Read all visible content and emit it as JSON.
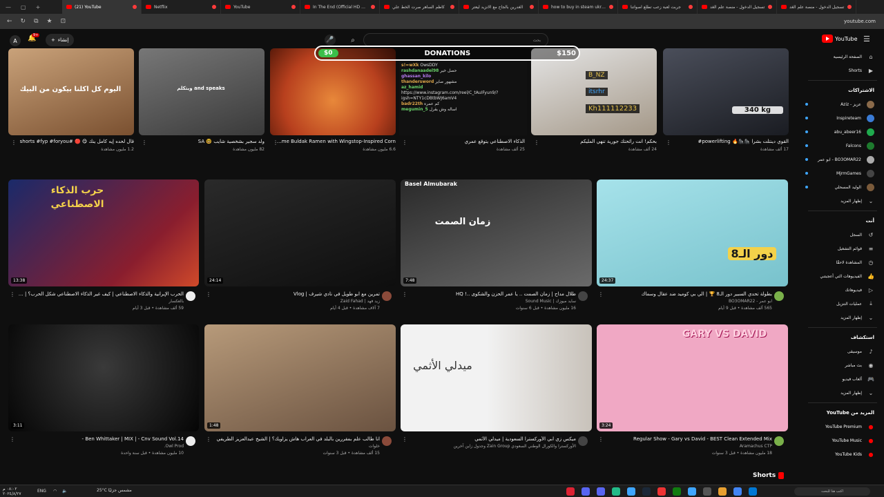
{
  "browser": {
    "tabs": [
      {
        "label": "(21) YouTube",
        "active": true
      },
      {
        "label": "Netflix"
      },
      {
        "label": "YouTube"
      },
      {
        "label": "In The End (Official HD Music"
      },
      {
        "label": "كاظم الساهر صرت الخط علي"
      },
      {
        "label": "الغدرين بالجاح مع الانزيد ليعتر"
      },
      {
        "label": "how to buy in steam ukraine"
      },
      {
        "label": "جربت لعبة زعب تطلع اصواتنا"
      },
      {
        "label": "تسجيل الدخول - منصة علم الغد"
      },
      {
        "label": "تسجيل الدخول - منصة علم الغد"
      }
    ],
    "url": "youtube.com"
  },
  "header": {
    "avatar_letter": "A",
    "notif_count": "9+",
    "create_label": "إنشاء",
    "search_placeholder": "بحث",
    "logo_text": "YouTube"
  },
  "sidebar": {
    "main": [
      "الصفحة الرئيسية",
      "Shorts"
    ],
    "subs_title": "الاشتراكات",
    "subs": [
      {
        "name": "عزيز - Aziz",
        "color": "#8a6a4a"
      },
      {
        "name": "Inspireteam",
        "color": "#3a7bd5"
      },
      {
        "name": "abu_abeer16",
        "color": "#1faa4d"
      },
      {
        "name": "Falcons",
        "color": "#1e7a2e"
      },
      {
        "name": "BO3OMAR22 - ابو عمر",
        "color": "#aaaaaa"
      },
      {
        "name": "MjrmGames",
        "color": "#444444"
      },
      {
        "name": "الوليد المسحلي",
        "color": "#7a5a3a"
      }
    ],
    "subs_more": "إظهار المزيد",
    "you_title": "أنت",
    "you_items": [
      "السجل",
      "قوائم التشغيل",
      "المشاهدة لاحقًا",
      "الفيديوهات التي أعجبتني",
      "فيديوهاتك",
      "عمليات التنزيل",
      "إظهار المزيد"
    ],
    "explore_title": "استكشاف",
    "explore_items": [
      "موسيقى",
      "بث مباشر",
      "ألعاب فيديو",
      "إظهار المزيد"
    ],
    "more_title": "المزيد من YouTube",
    "more_items": [
      "YouTube Premium",
      "YouTube Music",
      "YouTube Kids"
    ]
  },
  "stream": {
    "left_amount": "$0",
    "title": "DONATIONS",
    "right_amount": "$150",
    "chat": [
      {
        "u": "s!=wXk",
        "m": "OwsDDY"
      },
      {
        "u": "rashdanaadel98",
        "m": "حصل خير"
      },
      {
        "u": "ghassan_kilo",
        "m": ""
      },
      {
        "u": "thandersword",
        "m": "مشهور صاير"
      },
      {
        "u": "az_hamid",
        "m": ""
      },
      {
        "u": "",
        "m": "https://www.instagram.com/reel/C_tAuIFyun9/?igsh=NTY1cDBtbWJ6amV4"
      },
      {
        "u": "badr22th",
        "m": "كم عمره"
      },
      {
        "u": "megumin_5",
        "m": "اساله وش يقرل"
      }
    ],
    "nick1": "B_NZ",
    "nick2": "itsrhr",
    "nick3": "Kh111112233",
    "kg": "340 kg"
  },
  "row1": [
    {
      "title": "قال لحده إيه كامل ينك 😋 🔴 #shorts #fyp #foryou",
      "meta": "1.2 مليون مشاهدة",
      "thumb_text": "اليوم كل اكلنا بيكون من البيك"
    },
    {
      "title": "ولد سجير بشخصية شايب 🤓 SA",
      "meta": "82 مليون مشاهدة",
      "thumb_text": "ويتكلم and speaks"
    },
    {
      "title": "Habanero Lime Buldak Ramen with Wingstop-Inspired Corn 🔥",
      "meta": "6.6 مليون مشاهدة"
    },
    {
      "title": "الذكاء الاصطناعي يتوقع عمري",
      "meta": "25 ألف مشاهدة"
    },
    {
      "title": "بحكم! انت رائحتك جورية تنهي المليكم",
      "meta": "24 ألف مشاهدة"
    },
    {
      "title": "القوي دينتلت بشرا 🦍🦍🔥 powerlifting#",
      "meta": "17 ألف مشاهدة"
    }
  ],
  "row2": [
    {
      "title": "الحرب الإيرانية والذكاء الاصطناعي | كيف غير الذكاء الاصطناعي شكل الحرب؟ | بالعكسار",
      "channel": "بالعكسار",
      "meta": "59 ألف مشاهدة • قبل 3 أيام",
      "duration": "13:38",
      "thumb_text": "حرب الذكاء الاصطناعي"
    },
    {
      "title": "تمرين مع ابو طويل في نادي شيرف | Vlog",
      "channel": "زيد فهد | Zaid Fahad",
      "meta": "7 آلاف مشاهدة • قبل 4 أيام",
      "duration": "24:14"
    },
    {
      "title": "طلال مداح | زمان الصمت .. يا عمر الحزن والشكوى ..! HQ",
      "channel": "سايد ميوزك | Sound Music",
      "meta": "16 مليون مشاهدة • قبل 6 سنوات",
      "duration": "7:48",
      "thumb_text": "زمان الصمت",
      "sub": "Basel Almubarak"
    },
    {
      "title": "بطولة تحدي السبير دور الـ8 🏆 | الي بي كوميد ضد عقال وسماك",
      "channel": "ابو عمر - BO3OMAR22",
      "meta": "565 ألف مشاهدة • قبل 9 أيام",
      "duration": "24:37",
      "thumb_text": "دور الـ8"
    }
  ],
  "row3": [
    {
      "title": "Ben Whittaker | MIX | - Cnv Sound Vol.14 -",
      "channel": "Owl Prod.",
      "meta": "10 مليون مشاهدة • قبل سنة واحدة",
      "duration": "3:11"
    },
    {
      "title": "انا طالب علم بمقررين بالبلد في العراب هاش يزاويك؟ | الشيخ عبدالعزيز الطريفي",
      "channel": "خلوات",
      "meta": "15 ألف مشاهدة • قبل 3 سنوات",
      "duration": "1:48"
    },
    {
      "title": "ميكس زي ابي الأوركسترا السعودية | ميدلي الأثمي",
      "channel": "الأوركسترا والكورال الوطني السعودي Zain Group وجدول زاين آخرين",
      "meta": "",
      "duration": "",
      "thumb_text": "ميدلي الأثمي"
    },
    {
      "title": "Regular Show - Gary vs David - BEST Clean Extended Mix",
      "channel": "Aramachus CTP",
      "meta": "18 مليون مشاهدة • قبل 3 سنوات",
      "duration": "3:24",
      "thumb_text": "GARY VS DAVID"
    }
  ],
  "shorts_label": "Shorts",
  "taskbar": {
    "time": "٠٨:٠٢ م",
    "date": "٢٠٢٤/٨/٢٧",
    "lang": "ENG",
    "weather": "25°C مشمس جزئيًا",
    "search_placeholder": "اكتب هنا للبحث"
  }
}
